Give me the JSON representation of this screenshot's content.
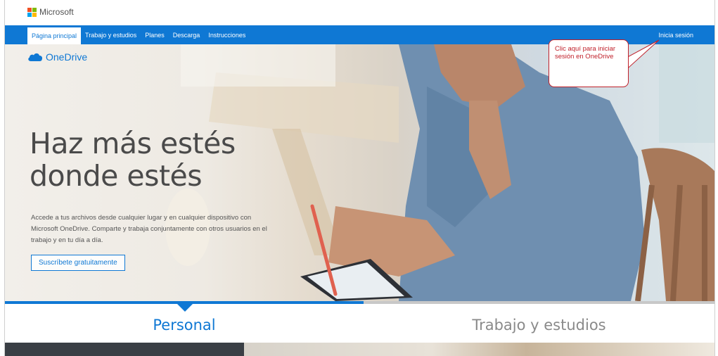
{
  "brand": {
    "name": "Microsoft",
    "colors": [
      "#f25022",
      "#7fba00",
      "#00a4ef",
      "#ffb900"
    ]
  },
  "nav": {
    "items": [
      {
        "label": "Página principal",
        "active": true
      },
      {
        "label": "Trabajo y estudios"
      },
      {
        "label": "Planes"
      },
      {
        "label": "Descarga"
      },
      {
        "label": "Instrucciones"
      }
    ],
    "signin": "Inicia sesión"
  },
  "hero": {
    "product": "OneDrive",
    "headline_line1": "Haz más estés",
    "headline_line2": "donde estés",
    "subtext": "Accede a tus archivos desde cualquier lugar y en cualquier dispositivo con Microsoft OneDrive. Comparte y trabaja conjuntamente con otros usuarios en el trabajo y en tu día a día.",
    "cta": "Suscríbete gratuitamente"
  },
  "callout": {
    "text": "Clic aquí para iniciar sesión en OneDrive"
  },
  "tabs": [
    {
      "label": "Personal",
      "active": true
    },
    {
      "label": "Trabajo y estudios"
    }
  ],
  "theme": {
    "accent": "#0f78d4",
    "callout": "#c0202a"
  }
}
